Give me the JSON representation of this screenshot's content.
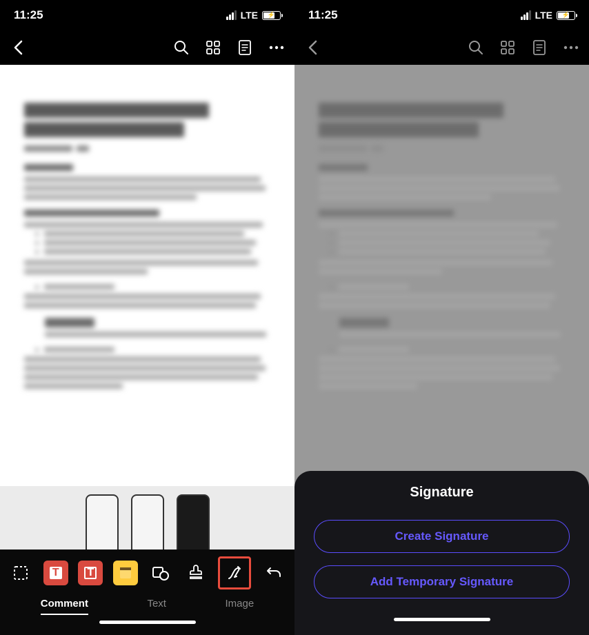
{
  "status": {
    "time": "11:25",
    "network": "LTE"
  },
  "left_screen": {
    "tools": {
      "select_icon": "dashed-select",
      "text_box_red": "T",
      "text_box_red2": "T",
      "sticky_note": "note",
      "shape": "circle-square",
      "stamp": "stamp",
      "signature": "pen-nib",
      "undo": "undo"
    },
    "tabs": {
      "comment": "Comment",
      "text": "Text",
      "image": "Image"
    }
  },
  "right_screen": {
    "sheet": {
      "title": "Signature",
      "create_btn": "Create Signature",
      "temp_btn": "Add Temporary Signature"
    }
  }
}
